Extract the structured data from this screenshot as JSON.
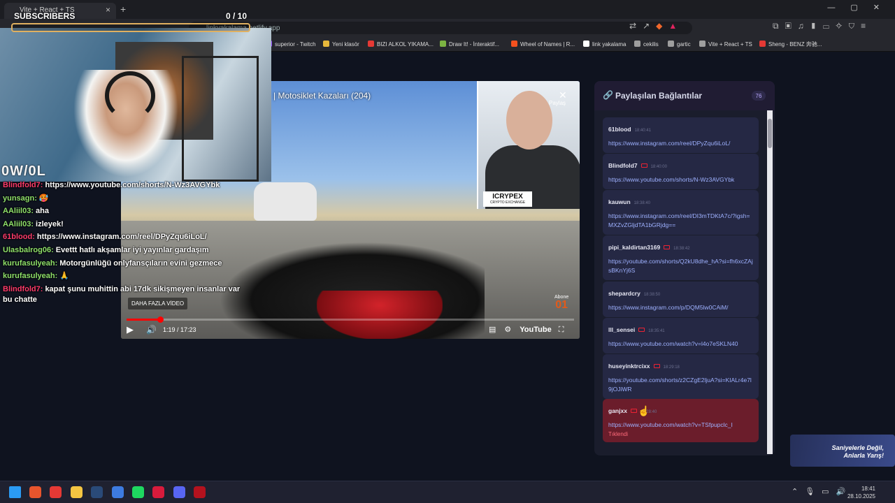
{
  "browser": {
    "tab_title": "Vite + React + TS",
    "tab_close": "×",
    "new_tab": "+",
    "window_controls": "—▢✕",
    "url": "linkyakalama.netlify.app",
    "bookmarks": [
      {
        "label": "superior - Twitch",
        "color": "#9146ff"
      },
      {
        "label": "Yeni klasör",
        "color": "#e7b83b"
      },
      {
        "label": "BIZI ALKOL YIKAMA...",
        "color": "#e53935"
      },
      {
        "label": "Draw It! - İnteraktif...",
        "color": "#7cb342"
      },
      {
        "label": "Wheel of Names | R...",
        "color": "#f4511e"
      },
      {
        "label": "link yakalama",
        "color": "#ffffff"
      },
      {
        "label": "cekilis",
        "color": "#9e9e9e"
      },
      {
        "label": "gartic",
        "color": "#9e9e9e"
      },
      {
        "label": "Vite + React + TS",
        "color": "#9e9e9e"
      },
      {
        "label": "Sheng - BENZ 奔驰...",
        "color": "#e53935"
      }
    ]
  },
  "overlay": {
    "subs_label": "SUBSCRIBERS",
    "subs_count": "0  / 10",
    "brand": "0W/0L"
  },
  "video": {
    "title": "| Motosiklet Kazaları (204)",
    "share": "Paylaş",
    "inset_brand": "ICRYPEX",
    "inset_sub": "CRYPTO EXCHANGE",
    "more_videos": "DAHA FAZLA VİDEO",
    "subscribe_top": "Abone",
    "subscribe_logo": "01",
    "time": "1:19 / 17:23",
    "youtube": "YouTube",
    "progress": 0.075
  },
  "chat": [
    {
      "name": "Blindfold7:",
      "color": "#ff3b6b",
      "msg": "https://www.youtube.com/shorts/N-Wz3AVGYbk"
    },
    {
      "name": "yunsagn:",
      "color": "#8fe06a",
      "msg": "🥵"
    },
    {
      "name": "AAliil03:",
      "color": "#8fe06a",
      "msg": "aha"
    },
    {
      "name": "AAliil03:",
      "color": "#8fe06a",
      "msg": "izleyek!"
    },
    {
      "name": "61blood:",
      "color": "#ff3b6b",
      "msg": "https://www.instagram.com/reel/DPyZqu6iLoL/"
    },
    {
      "name": "Ulasbalrog06:",
      "color": "#8fe06a",
      "msg": "Evettt hatlı akşamlar iyi yayınlar gardaşım"
    },
    {
      "name": "kurufasulyeah:",
      "color": "#8fe06a",
      "msg": "Motorgünlüğü onlyfansçıların evini gezmece"
    },
    {
      "name": "kurufasulyeah:",
      "color": "#8fe06a",
      "msg": "🙏"
    },
    {
      "name": "Blindfold7:",
      "color": "#ff3b6b",
      "msg": "kapat şunu muhittin abi 17dk sikişmeyen insanlar var bu chatte"
    }
  ],
  "panel": {
    "title": "Paylaşılan Bağlantılar",
    "count": "76",
    "links": [
      {
        "user": "61blood",
        "time": "18:40:41",
        "yt": false,
        "url": "https://www.instagram.com/reel/DPyZqu6iLoL/"
      },
      {
        "user": "Blindfold7",
        "time": "18:40:00",
        "yt": true,
        "url": "https://www.youtube.com/shorts/N-Wz3AVGYbk"
      },
      {
        "user": "kauwun",
        "time": "18:38:40",
        "yt": false,
        "url": "https://www.instagram.com/reel/DI3mTDKtA7c/?igsh=MXZvZGljdTA1bGRjdg=="
      },
      {
        "user": "pipi_kaldirtan3169",
        "time": "18:38:42",
        "yt": true,
        "url": "https://youtube.com/shorts/Q2kU8dhe_hA?si=fh6xcZAjsBKnYj6S"
      },
      {
        "user": "shepardcry",
        "time": "18:38:50",
        "yt": false,
        "url": "https://www.instagram.com/p/DQM5lw0CAiM/"
      },
      {
        "user": "lll_sensei",
        "time": "18:35:41",
        "yt": true,
        "url": "https://www.youtube.com/watch?v=l4o7eSKLN40"
      },
      {
        "user": "huseyinktrcixx",
        "time": "18:29:18",
        "yt": true,
        "url": "https://youtube.com/shorts/z2CZgE2ljuA?si=KIALr4e7l9jOJiWR"
      },
      {
        "user": "ganjxx",
        "time": "18:28:40",
        "yt": true,
        "url": "https://www.youtube.com/watch?v=TSfpupclc_I",
        "error": "Tıklendi"
      }
    ]
  },
  "promo": {
    "line1": "Saniyelerle Değil,",
    "line2": "Anlarla Yarış!"
  },
  "taskbar": {
    "time": "18:41",
    "date": "28.10.2025",
    "tray": "⌃🎙▭🔊",
    "apps": [
      {
        "name": "windows",
        "color": "#2b9bf4"
      },
      {
        "name": "brave",
        "color": "#e8552d"
      },
      {
        "name": "maps",
        "color": "#e53935"
      },
      {
        "name": "files",
        "color": "#f4c542"
      },
      {
        "name": "steam",
        "color": "#2a4a78"
      },
      {
        "name": "app-blue",
        "color": "#3d7be0"
      },
      {
        "name": "spotify",
        "color": "#1ed760"
      },
      {
        "name": "app-red",
        "color": "#d81b3c"
      },
      {
        "name": "discord",
        "color": "#5865f2"
      },
      {
        "name": "netflix",
        "color": "#b3121e"
      }
    ]
  }
}
